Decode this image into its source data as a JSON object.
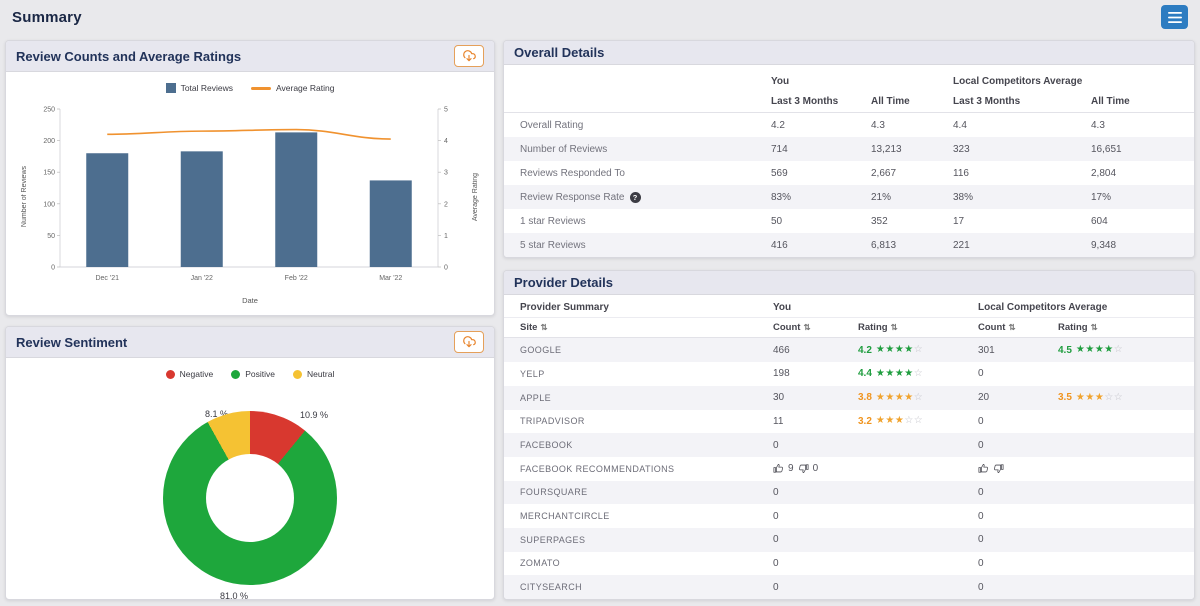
{
  "app": {
    "title": "Summary"
  },
  "colors": {
    "bar": "#4d6e8f",
    "line": "#f0922f",
    "accent_orange": "#e8842c",
    "menu_button": "#2d7cc1",
    "rating_good": "#1f9d3f",
    "rating_mid": "#f0941f"
  },
  "review_counts_panel": {
    "title": "Review Counts and Average Ratings"
  },
  "review_sentiment_panel": {
    "title": "Review Sentiment"
  },
  "overall_details": {
    "title": "Overall Details",
    "groups": [
      "You",
      "Local Competitors Average"
    ],
    "subheaders": [
      "Last 3 Months",
      "All Time",
      "Last 3 Months",
      "All Time"
    ],
    "rows": [
      {
        "label": "Overall Rating",
        "values": [
          "4.2",
          "4.3",
          "4.4",
          "4.3"
        ]
      },
      {
        "label": "Number of Reviews",
        "values": [
          "714",
          "13,213",
          "323",
          "16,651"
        ]
      },
      {
        "label": "Reviews Responded To",
        "values": [
          "569",
          "2,667",
          "116",
          "2,804"
        ]
      },
      {
        "label": "Review Response Rate",
        "help": true,
        "values": [
          "83%",
          "21%",
          "38%",
          "17%"
        ]
      },
      {
        "label": "1 star Reviews",
        "values": [
          "50",
          "352",
          "17",
          "604"
        ]
      },
      {
        "label": "5 star Reviews",
        "values": [
          "416",
          "6,813",
          "221",
          "9,348"
        ]
      }
    ]
  },
  "provider_details": {
    "title": "Provider Details",
    "groups": [
      "Provider Summary",
      "You",
      "Local Competitors Average"
    ],
    "columns": [
      "Site",
      "Count",
      "Rating",
      "Count",
      "Rating"
    ],
    "rows": [
      {
        "site": "GOOGLE",
        "you_count": "466",
        "you_rating": "4.2",
        "you_stars": 4,
        "you_tone": "good",
        "comp_count": "301",
        "comp_rating": "4.5",
        "comp_stars": 4,
        "comp_tone": "good"
      },
      {
        "site": "YELP",
        "you_count": "198",
        "you_rating": "4.4",
        "you_stars": 4,
        "you_tone": "good",
        "comp_count": "0"
      },
      {
        "site": "APPLE",
        "you_count": "30",
        "you_rating": "3.8",
        "you_stars": 4,
        "you_tone": "mid",
        "comp_count": "20",
        "comp_rating": "3.5",
        "comp_stars": 3,
        "comp_tone": "mid"
      },
      {
        "site": "TRIPADVISOR",
        "you_count": "11",
        "you_rating": "3.2",
        "you_stars": 3,
        "you_tone": "mid",
        "comp_count": "0"
      },
      {
        "site": "FACEBOOK",
        "you_count": "0",
        "comp_count": "0"
      },
      {
        "site": "FACEBOOK RECOMMENDATIONS",
        "you_thumbs": {
          "up": "9",
          "down": "0"
        },
        "comp_thumbs": {
          "up": "",
          "down": ""
        }
      },
      {
        "site": "FOURSQUARE",
        "you_count": "0",
        "comp_count": "0"
      },
      {
        "site": "MERCHANTCIRCLE",
        "you_count": "0",
        "comp_count": "0"
      },
      {
        "site": "SUPERPAGES",
        "you_count": "0",
        "comp_count": "0"
      },
      {
        "site": "ZOMATO",
        "you_count": "0",
        "comp_count": "0"
      },
      {
        "site": "CITYSEARCH",
        "you_count": "0",
        "comp_count": "0"
      }
    ]
  },
  "chart_data": [
    {
      "type": "bar",
      "title": "Review Counts and Average Ratings",
      "categories": [
        "Dec '21",
        "Jan '22",
        "Feb '22",
        "Mar '22"
      ],
      "series": [
        {
          "name": "Total Reviews",
          "kind": "bar",
          "axis": "left",
          "values": [
            180,
            183,
            213,
            137
          ]
        },
        {
          "name": "Average Rating",
          "kind": "line",
          "axis": "right",
          "values": [
            4.2,
            4.3,
            4.35,
            4.05
          ]
        }
      ],
      "xlabel": "Date",
      "ylabel_left": "Number of Reviews",
      "ylim_left": [
        0,
        250
      ],
      "yticks_left": [
        0,
        50,
        100,
        150,
        200,
        250
      ],
      "ylabel_right": "Average Rating",
      "ylim_right": [
        0,
        5
      ],
      "yticks_right": [
        0,
        1,
        2,
        3,
        4,
        5
      ],
      "legend_position": "top",
      "grid": false
    },
    {
      "type": "pie",
      "title": "Review Sentiment",
      "labels": [
        "Negative",
        "Positive",
        "Neutral"
      ],
      "values": [
        10.9,
        81.0,
        8.1
      ],
      "colors": [
        "#d8382f",
        "#1ea73c",
        "#f5c233"
      ],
      "data_labels": [
        "10.9 %",
        "81.0 %",
        "8.1 %"
      ],
      "donut": true,
      "legend_position": "top"
    }
  ]
}
